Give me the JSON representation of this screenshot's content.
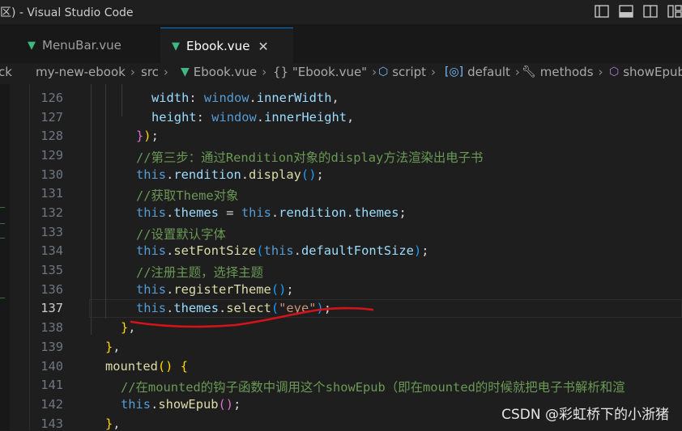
{
  "window": {
    "title": "区) - Visual Studio Code"
  },
  "tabs": [
    {
      "label": "MenuBar.vue",
      "icon": "vue-icon"
    },
    {
      "label": "Ebook.vue",
      "icon": "vue-icon",
      "close": "✕"
    }
  ],
  "breadcrumbs": {
    "partial": "ck",
    "items": [
      "my-new-ebook",
      "src",
      "Ebook.vue",
      "{} \"Ebook.vue\"",
      "script",
      "default",
      "methods",
      "showEpub"
    ]
  },
  "code": {
    "lines": [
      {
        "n": "126",
        "text": "width: window.innerWidth,"
      },
      {
        "n": "127",
        "text": "height: window.innerHeight,"
      },
      {
        "n": "128",
        "text": "});"
      },
      {
        "n": "129",
        "text": "//第三步：通过Rendition对象的display方法渲染出电子书"
      },
      {
        "n": "130",
        "text": "this.rendition.display();"
      },
      {
        "n": "131",
        "text": "//获取Theme对象"
      },
      {
        "n": "132",
        "text": "this.themes = this.rendition.themes;"
      },
      {
        "n": "133",
        "text": "//设置默认字体"
      },
      {
        "n": "134",
        "text": "this.setFontSize(this.defaultFontSize);"
      },
      {
        "n": "135",
        "text": "//注册主题，选择主题"
      },
      {
        "n": "136",
        "text": "this.registerTheme();"
      },
      {
        "n": "137",
        "text": "this.themes.select(\"eye\");"
      },
      {
        "n": "138",
        "text": "},"
      },
      {
        "n": "139",
        "text": "},"
      },
      {
        "n": "140",
        "text": "mounted() {"
      },
      {
        "n": "141",
        "text": "//在mounted的钩子函数中调用这个showEpub（即在mounted的时候就把电子书解析和渲"
      },
      {
        "n": "142",
        "text": "this.showEpub();"
      },
      {
        "n": "143",
        "text": "},"
      }
    ]
  },
  "watermark": "CSDN @彩虹桥下的小浙猪",
  "colors": {
    "background": "#1e1e1e",
    "accent": "#0078d4",
    "annotation": "#d4141a",
    "vue": "#41b883"
  }
}
